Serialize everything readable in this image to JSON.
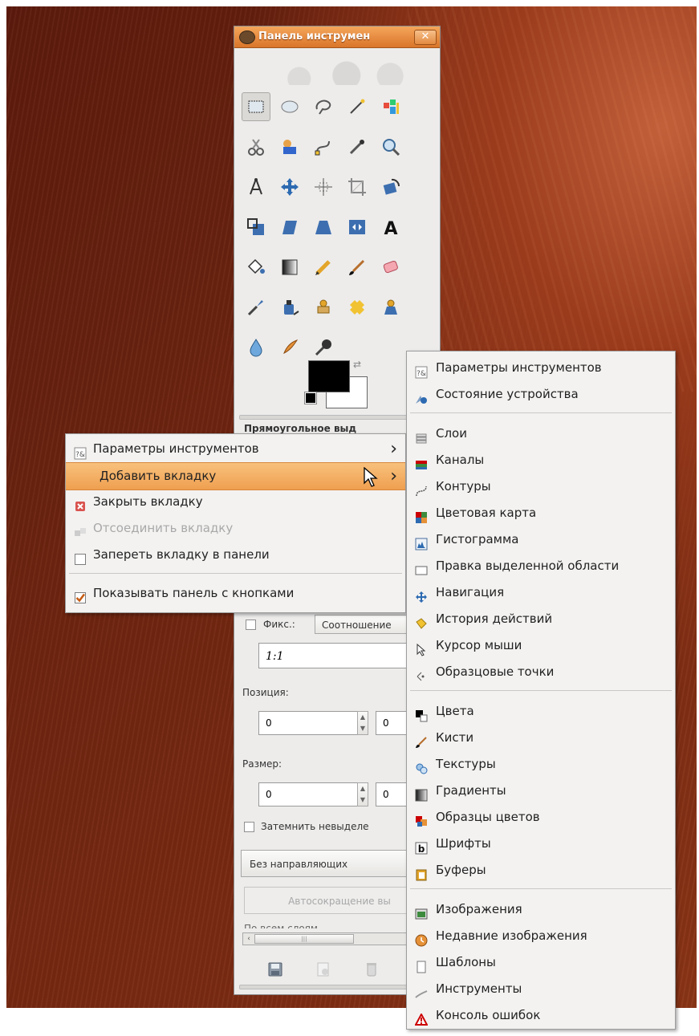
{
  "window": {
    "title": "Панель инструмен",
    "close_glyph": "✕"
  },
  "tools": [
    {
      "name": "rect-select-icon",
      "active": true
    },
    {
      "name": "ellipse-select-icon"
    },
    {
      "name": "free-select-icon"
    },
    {
      "name": "fuzzy-select-icon"
    },
    {
      "name": "select-by-color-icon"
    },
    {
      "name": "scissors-icon"
    },
    {
      "name": "foreground-select-icon"
    },
    {
      "name": "paths-icon"
    },
    {
      "name": "color-picker-icon"
    },
    {
      "name": "zoom-icon"
    },
    {
      "name": "measure-icon"
    },
    {
      "name": "move-icon"
    },
    {
      "name": "align-icon"
    },
    {
      "name": "crop-icon"
    },
    {
      "name": "rotate-icon"
    },
    {
      "name": "scale-icon"
    },
    {
      "name": "shear-icon"
    },
    {
      "name": "perspective-icon"
    },
    {
      "name": "flip-icon"
    },
    {
      "name": "text-icon"
    },
    {
      "name": "bucket-fill-icon"
    },
    {
      "name": "blend-icon"
    },
    {
      "name": "pencil-icon"
    },
    {
      "name": "paintbrush-icon"
    },
    {
      "name": "eraser-icon"
    },
    {
      "name": "airbrush-icon"
    },
    {
      "name": "ink-icon"
    },
    {
      "name": "clone-icon"
    },
    {
      "name": "heal-icon"
    },
    {
      "name": "perspective-clone-icon"
    },
    {
      "name": "blur-icon"
    },
    {
      "name": "smudge-icon"
    },
    {
      "name": "dodge-burn-icon"
    }
  ],
  "options": {
    "dock_title": "Прямоугольное выд",
    "fixed_label": "Фикс.:",
    "ratio_mode": "Соотношение",
    "ratio_value": "1:1",
    "position_label": "Позиция:",
    "position_x": "0",
    "position_y": "0",
    "size_label": "Размер:",
    "size_w": "0",
    "size_h": "0",
    "dim_label": "Затемнить невыделе",
    "guides_value": "Без направляющих",
    "autoshrink_label": "Автосокращение вы",
    "partial_label": "По всем слоям"
  },
  "context_menu": {
    "items": [
      {
        "label": "Параметры инструментов",
        "icon": "tool-options-icon",
        "submenu": true
      },
      {
        "label": "Добавить вкладку",
        "submenu": true,
        "highlighted": true
      },
      {
        "label": "Закрыть вкладку",
        "icon": "close-tab-icon"
      },
      {
        "label": "Отсоединить вкладку",
        "icon": "detach-tab-icon",
        "disabled": true
      },
      {
        "label": "Запереть вкладку в панели",
        "checkbox": true,
        "checked": false
      },
      {
        "label": "Показывать панель с кнопками",
        "checkbox": true,
        "checked": true
      }
    ]
  },
  "submenu": {
    "groups": [
      [
        {
          "label": "Параметры инструментов",
          "icon": "tool-options-icon"
        },
        {
          "label": "Состояние устройства",
          "icon": "device-status-icon"
        }
      ],
      [
        {
          "label": "Слои",
          "icon": "layers-icon"
        },
        {
          "label": "Каналы",
          "icon": "channels-icon"
        },
        {
          "label": "Контуры",
          "icon": "paths-icon"
        },
        {
          "label": "Цветовая карта",
          "icon": "colormap-icon"
        },
        {
          "label": "Гистограмма",
          "icon": "histogram-icon"
        },
        {
          "label": "Правка выделенной области",
          "icon": "selection-editor-icon"
        },
        {
          "label": "Навигация",
          "icon": "navigation-icon"
        },
        {
          "label": "История действий",
          "icon": "undo-history-icon"
        },
        {
          "label": "Курсор мыши",
          "icon": "pointer-icon"
        },
        {
          "label": "Образцовые точки",
          "icon": "sample-points-icon"
        }
      ],
      [
        {
          "label": "Цвета",
          "icon": "colors-icon"
        },
        {
          "label": "Кисти",
          "icon": "brushes-icon"
        },
        {
          "label": "Текстуры",
          "icon": "patterns-icon"
        },
        {
          "label": "Градиенты",
          "icon": "gradients-icon"
        },
        {
          "label": "Образцы цветов",
          "icon": "palettes-icon"
        },
        {
          "label": "Шрифты",
          "icon": "fonts-icon"
        },
        {
          "label": "Буферы",
          "icon": "buffers-icon"
        }
      ],
      [
        {
          "label": "Изображения",
          "icon": "images-icon"
        },
        {
          "label": "Недавние изображения",
          "icon": "recent-images-icon"
        },
        {
          "label": "Шаблоны",
          "icon": "templates-icon"
        },
        {
          "label": "Инструменты",
          "icon": "tools-icon"
        },
        {
          "label": "Консоль ошибок",
          "icon": "error-console-icon"
        }
      ]
    ]
  },
  "colors": {
    "foreground": "#000000",
    "background": "#ffffff",
    "menu_highlight": "#f2a654"
  }
}
